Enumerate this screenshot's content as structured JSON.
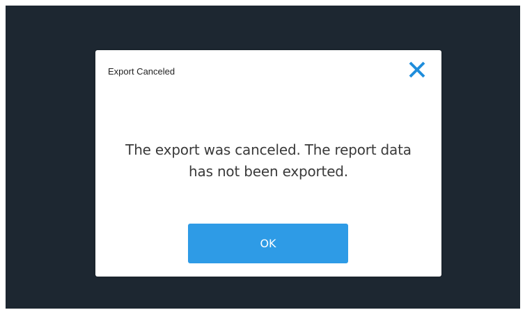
{
  "dialog": {
    "title": "Export Canceled",
    "message": "The export was canceled. The report data has not been exported.",
    "ok_label": "OK",
    "close_icon": "close-icon"
  },
  "colors": {
    "overlay_background": "#1d2731",
    "dialog_background": "#ffffff",
    "accent": "#2e9be6",
    "close_icon": "#1f8ddb",
    "text": "#3a3a3a"
  }
}
